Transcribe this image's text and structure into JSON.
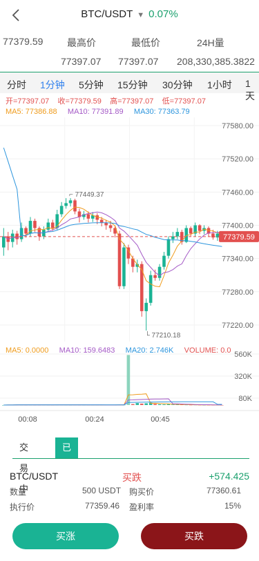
{
  "header": {
    "pair": "BTC/USDT",
    "change": "0.07%"
  },
  "stats": {
    "last_price": "77379.59",
    "high_label": "最高价",
    "low_label": "最低价",
    "vol_label": "24H量",
    "high": "77397.07",
    "low": "77397.07",
    "volume": "208,330,385.3822"
  },
  "tabs": [
    "分时",
    "1分钟",
    "5分钟",
    "15分钟",
    "30分钟",
    "1小时",
    "1天"
  ],
  "active_tab_index": 1,
  "ohlc": {
    "open": "开=77397.07",
    "close": "收=77379.59",
    "high": "高=77397.07",
    "low": "低=77397.07"
  },
  "ma": {
    "ma5": "MA5: 77386.88",
    "ma10": "MA10: 77391.89",
    "ma30": "MA30: 77363.79"
  },
  "vol_ma": {
    "ma5": "MA5: 0.0000",
    "ma10": "MA10: 159.6483",
    "ma20": "MA20: 2.746K",
    "volume": "VOLUME: 0.0"
  },
  "chart_data": {
    "type": "candlestick",
    "price_axis": {
      "ticks": [
        77580,
        77520,
        77460,
        77400,
        77340,
        77280,
        77220
      ],
      "tick_labels": [
        "77580.00",
        "77520.00",
        "77460.00",
        "77400.00",
        "77340.00",
        "77280.00",
        "77220.00"
      ],
      "range": [
        77205,
        77590
      ]
    },
    "volume_axis": {
      "tick_labels": [
        "560K",
        "320K",
        "80K"
      ]
    },
    "time_labels": [
      "00:08",
      "00:24",
      "00:45"
    ],
    "current_price": "77379.59",
    "max_annotation": "77449.37",
    "min_annotation": "77210.18",
    "candles": [
      [
        77360,
        77380,
        77395,
        77345
      ],
      [
        77380,
        77370,
        77388,
        77355
      ],
      [
        77370,
        77385,
        77392,
        77360
      ],
      [
        77385,
        77375,
        77390,
        77365
      ],
      [
        77375,
        77395,
        77405,
        77370
      ],
      [
        77395,
        77385,
        77398,
        77378
      ],
      [
        77385,
        77408,
        77415,
        77380
      ],
      [
        77408,
        77395,
        77412,
        77388
      ],
      [
        77395,
        77380,
        77398,
        77372
      ],
      [
        77380,
        77392,
        77398,
        77375
      ],
      [
        77392,
        77405,
        77412,
        77388
      ],
      [
        77405,
        77395,
        77410,
        77390
      ],
      [
        77395,
        77420,
        77428,
        77392
      ],
      [
        77420,
        77435,
        77442,
        77415
      ],
      [
        77435,
        77440,
        77449,
        77430
      ],
      [
        77440,
        77445,
        77449,
        77434
      ],
      [
        77445,
        77425,
        77448,
        77420
      ],
      [
        77425,
        77415,
        77430,
        77405
      ],
      [
        77415,
        77420,
        77426,
        77410
      ],
      [
        77420,
        77412,
        77425,
        77405
      ],
      [
        77412,
        77418,
        77424,
        77406
      ],
      [
        77418,
        77410,
        77422,
        77402
      ],
      [
        77410,
        77405,
        77415,
        77398
      ],
      [
        77405,
        77400,
        77410,
        77392
      ],
      [
        77400,
        77395,
        77408,
        77388
      ],
      [
        77395,
        77385,
        77400,
        77378
      ],
      [
        77385,
        77290,
        77390,
        77285
      ],
      [
        77290,
        77360,
        77368,
        77285
      ],
      [
        77360,
        77340,
        77365,
        77330
      ],
      [
        77340,
        77325,
        77345,
        77315
      ],
      [
        77325,
        77330,
        77338,
        77315
      ],
      [
        77330,
        77245,
        77335,
        77235
      ],
      [
        77245,
        77260,
        77268,
        77210
      ],
      [
        77260,
        77310,
        77318,
        77255
      ],
      [
        77310,
        77305,
        77320,
        77300
      ],
      [
        77305,
        77325,
        77330,
        77300
      ],
      [
        77325,
        77345,
        77352,
        77320
      ],
      [
        77345,
        77375,
        77380,
        77340
      ],
      [
        77375,
        77380,
        77388,
        77368
      ],
      [
        77380,
        77388,
        77395,
        77375
      ],
      [
        77388,
        77370,
        77392,
        77365
      ],
      [
        77370,
        77395,
        77400,
        77368
      ],
      [
        77395,
        77385,
        77398,
        77380
      ],
      [
        77385,
        77400,
        77405,
        77380
      ],
      [
        77400,
        77390,
        77402,
        77384
      ],
      [
        77390,
        77395,
        77400,
        77384
      ],
      [
        77395,
        77385,
        77398,
        77380
      ],
      [
        77385,
        77378,
        77392,
        77374
      ],
      [
        77378,
        77385,
        77390,
        77372
      ],
      [
        77385,
        77380,
        77388,
        77376
      ]
    ],
    "volumes": [
      0,
      2,
      1,
      3,
      2,
      1,
      2,
      1,
      1,
      2,
      1,
      1,
      2,
      3,
      2,
      1,
      2,
      1,
      1,
      1,
      1,
      1,
      1,
      1,
      2,
      1,
      3,
      2,
      620,
      12,
      25,
      18,
      22,
      30,
      14,
      10,
      8,
      12,
      6,
      5,
      4,
      3,
      2,
      3,
      2,
      1,
      1,
      1,
      1,
      0
    ]
  },
  "trade_tabs": {
    "open": "交易中",
    "closed": "已平仓"
  },
  "position": {
    "pair": "BTC/USDT",
    "side": "买跌",
    "pnl": "+574.425",
    "qty_label": "数量",
    "qty": "500 USDT",
    "buy_label": "购买价",
    "buy": "77360.61",
    "exec_label": "执行价",
    "exec": "77359.46",
    "rate_label": "盈利率",
    "rate": "15%"
  },
  "buttons": {
    "up": "买涨",
    "down": "买跌"
  },
  "colors": {
    "up": "#1ab394",
    "down": "#e2504f",
    "accent": "#2f80ed",
    "ma5": "#ef9b1c",
    "ma10": "#a459c6",
    "ma30": "#2c95dd"
  }
}
